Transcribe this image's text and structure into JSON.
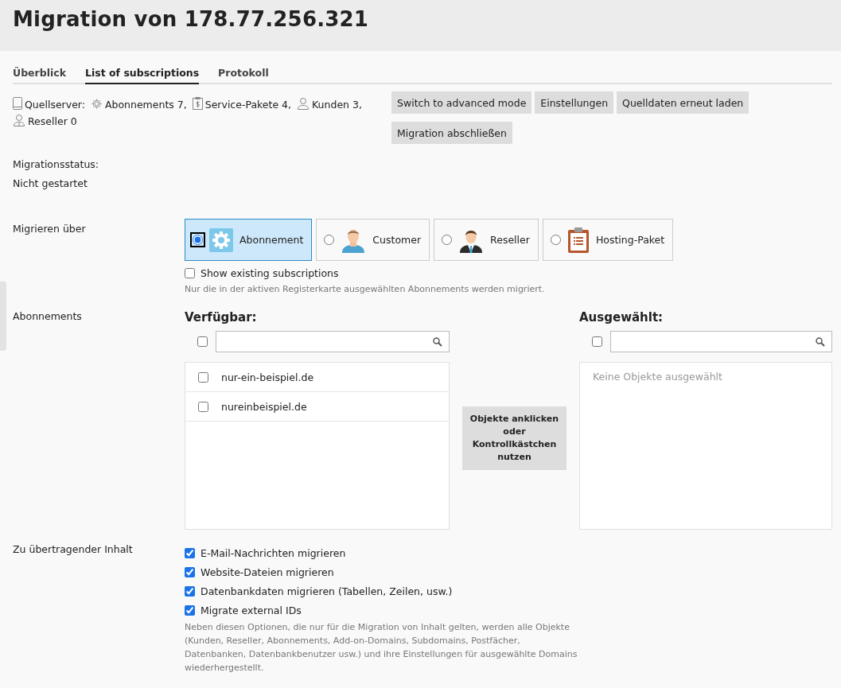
{
  "title": "Migration von 178.77.256.321",
  "tabs": [
    {
      "label": "Überblick",
      "selected": false
    },
    {
      "label": "List of subscriptions",
      "selected": true
    },
    {
      "label": "Protokoll",
      "selected": false
    }
  ],
  "source_server": {
    "label": "Quellserver:",
    "items": [
      {
        "kind": "subscriptions",
        "text": "Abonnements 7,"
      },
      {
        "kind": "service_plans",
        "text": "Service-Pakete 4,"
      },
      {
        "kind": "customers",
        "text": "Kunden 3,"
      },
      {
        "kind": "resellers",
        "text": "Reseller 0"
      }
    ]
  },
  "buttons": [
    "Switch to advanced mode",
    "Einstellungen",
    "Quelldaten erneut laden",
    "Migration abschließen"
  ],
  "migration_status": {
    "label": "Migrationsstatus:",
    "value": "Nicht gestartet"
  },
  "migrate_via": {
    "label": "Migrieren über",
    "options": [
      {
        "kind": "subscription",
        "label": "Abonnement",
        "selected": true
      },
      {
        "kind": "customer",
        "label": "Customer",
        "selected": false
      },
      {
        "kind": "reseller",
        "label": "Reseller",
        "selected": false
      },
      {
        "kind": "plan",
        "label": "Hosting-Paket",
        "selected": false
      }
    ],
    "show_existing": {
      "label": "Show existing subscriptions",
      "checked": false
    },
    "hint": "Nur die in der aktiven Registerkarte ausgewählten Abonnements werden migriert."
  },
  "subscriptions": {
    "label": "Abonnements",
    "available": {
      "title": "Verfügbar:",
      "select_all_checked": false,
      "items": [
        {
          "name": "nur-ein-beispiel.de",
          "checked": false
        },
        {
          "name": "nureinbeispiel.de",
          "checked": false
        }
      ]
    },
    "transfer_button": "Objekte anklicken oder Kontrollkästchen nutzen",
    "selected": {
      "title": "Ausgewählt:",
      "select_all_checked": false,
      "empty_text": "Keine Objekte ausgewählt"
    }
  },
  "content": {
    "label": "Zu übertragender Inhalt",
    "options": [
      {
        "label": "E-Mail-Nachrichten migrieren",
        "checked": true
      },
      {
        "label": "Website-Dateien migrieren",
        "checked": true
      },
      {
        "label": "Datenbankdaten migrieren (Tabellen, Zeilen, usw.)",
        "checked": true
      },
      {
        "label": "Migrate external IDs",
        "checked": true
      }
    ],
    "note": "Neben diesen Optionen, die nur für die Migration von Inhalt gelten, werden alle Objekte (Kunden, Reseller, Abonnements, Add-on-Domains, Subdomains, Postfächer, Datenbanken, Datenbankbenutzer usw.) und ihre Einstellungen für ausgewählte Domains wiederhergestellt."
  }
}
